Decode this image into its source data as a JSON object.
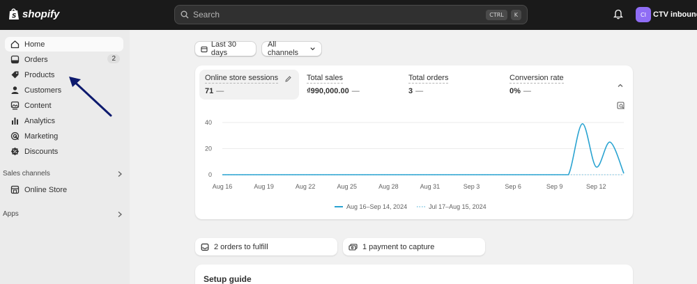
{
  "topbar": {
    "brand": "shopify",
    "search_placeholder": "Search",
    "shortcut_keys": [
      "CTRL",
      "K"
    ],
    "avatar_initials": "CI",
    "store_name": "CTV inbound"
  },
  "sidebar": {
    "items": [
      {
        "label": "Home",
        "icon": "home-icon",
        "active": true
      },
      {
        "label": "Orders",
        "icon": "orders-icon",
        "badge": "2"
      },
      {
        "label": "Products",
        "icon": "tag-icon"
      },
      {
        "label": "Customers",
        "icon": "person-icon"
      },
      {
        "label": "Content",
        "icon": "content-icon"
      },
      {
        "label": "Analytics",
        "icon": "bar-chart-icon"
      },
      {
        "label": "Marketing",
        "icon": "target-icon"
      },
      {
        "label": "Discounts",
        "icon": "discount-icon"
      }
    ],
    "sales_channels_label": "Sales channels",
    "online_store_label": "Online Store",
    "apps_label": "Apps",
    "annotation_arrow_color": "#0d1a6e"
  },
  "filters": {
    "date_range": "Last 30 days",
    "channels": "All channels"
  },
  "metrics": [
    {
      "label": "Online store sessions",
      "value": "71",
      "trend": "—",
      "selected": true
    },
    {
      "label": "Total sales",
      "value": "₫990,000.00",
      "trend": "—"
    },
    {
      "label": "Total orders",
      "value": "3",
      "trend": "—"
    },
    {
      "label": "Conversion rate",
      "value": "0%",
      "trend": "—"
    }
  ],
  "chart_data": {
    "type": "line",
    "x_ticks": [
      "Aug 16",
      "Aug 19",
      "Aug 22",
      "Aug 25",
      "Aug 28",
      "Aug 31",
      "Sep 3",
      "Sep 6",
      "Sep 9",
      "Sep 12"
    ],
    "y_ticks": [
      "40",
      "20",
      "0"
    ],
    "ylim": [
      0,
      40
    ],
    "series": [
      {
        "name": "Aug 16–Sep 14, 2024",
        "color": "#29a3d1",
        "style": "solid",
        "x": [
          "Aug 16",
          "Aug 17",
          "Aug 18",
          "Aug 19",
          "Aug 20",
          "Aug 21",
          "Aug 22",
          "Aug 23",
          "Aug 24",
          "Aug 25",
          "Aug 26",
          "Aug 27",
          "Aug 28",
          "Aug 29",
          "Aug 30",
          "Aug 31",
          "Sep 1",
          "Sep 2",
          "Sep 3",
          "Sep 4",
          "Sep 5",
          "Sep 6",
          "Sep 7",
          "Sep 8",
          "Sep 9",
          "Sep 10",
          "Sep 11",
          "Sep 12",
          "Sep 13",
          "Sep 14"
        ],
        "values": [
          0,
          0,
          0,
          0,
          0,
          0,
          0,
          0,
          0,
          0,
          0,
          0,
          0,
          0,
          0,
          0,
          0,
          0,
          0,
          0,
          0,
          0,
          0,
          0,
          0,
          0,
          39,
          6,
          25,
          1
        ]
      },
      {
        "name": "Jul 17–Aug 15, 2024",
        "color": "#7fc7e3",
        "style": "dotted",
        "values": [
          0,
          0,
          0,
          0,
          0,
          0,
          0,
          0,
          0,
          0,
          0,
          0,
          0,
          0,
          0,
          0,
          0,
          0,
          0,
          0,
          0,
          0,
          0,
          0,
          0,
          0,
          0,
          0,
          0,
          0
        ]
      }
    ]
  },
  "actions": {
    "fulfill": "2 orders to fulfill",
    "payment": "1 payment to capture"
  },
  "setup_guide": {
    "title": "Setup guide"
  }
}
